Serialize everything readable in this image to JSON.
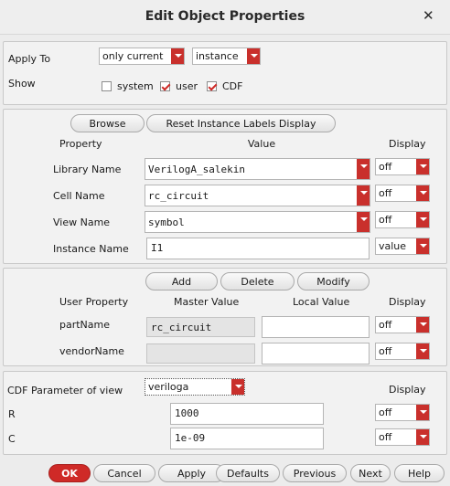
{
  "window": {
    "title": "Edit Object Properties",
    "close_label": "✕"
  },
  "apply": {
    "label": "Apply To",
    "scope": "only current",
    "object": "instance",
    "show_label": "Show",
    "show_options": [
      {
        "label": "system",
        "checked": false
      },
      {
        "label": "user",
        "checked": true
      },
      {
        "label": "CDF",
        "checked": true
      }
    ]
  },
  "props": {
    "browse": "Browse",
    "reset": "Reset Instance Labels Display",
    "col_property": "Property",
    "col_value": "Value",
    "col_display": "Display",
    "rows": [
      {
        "name": "Library Name",
        "value": "VerilogA_salekin",
        "display": "off"
      },
      {
        "name": "Cell Name",
        "value": "rc_circuit",
        "display": "off"
      },
      {
        "name": "View Name",
        "value": "symbol",
        "display": "off"
      },
      {
        "name": "Instance Name",
        "value": "I1",
        "display": "value"
      }
    ]
  },
  "user": {
    "add": "Add",
    "delete": "Delete",
    "modify": "Modify",
    "col_user_property": "User Property",
    "col_master": "Master Value",
    "col_local": "Local Value",
    "col_display": "Display",
    "rows": [
      {
        "name": "partName",
        "master": "rc_circuit",
        "local": "",
        "display": "off"
      },
      {
        "name": "vendorName",
        "master": "",
        "local": "",
        "display": "off"
      }
    ]
  },
  "cdf": {
    "label": "CDF Parameter of view",
    "view": "veriloga",
    "col_display": "Display",
    "params": [
      {
        "name": "R",
        "value": "1000",
        "display": "off"
      },
      {
        "name": "C",
        "value": "1e-09",
        "display": "off"
      }
    ]
  },
  "footer": {
    "ok": "OK",
    "cancel": "Cancel",
    "apply": "Apply",
    "defaults": "Defaults",
    "previous": "Previous",
    "next": "Next",
    "help": "Help"
  },
  "colors": {
    "accent": "#cf2a27",
    "panel_bg": "#f2f2f2",
    "window_bg": "#ececec"
  }
}
